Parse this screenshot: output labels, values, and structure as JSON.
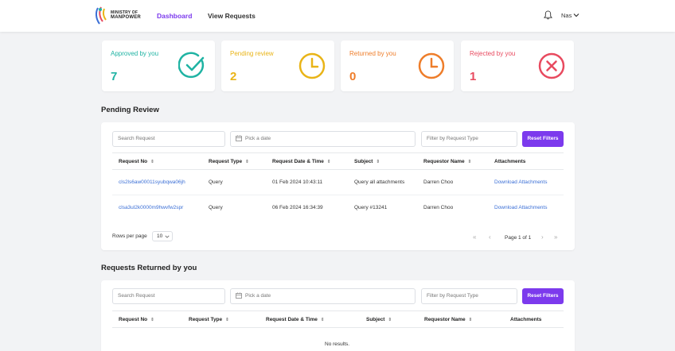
{
  "header": {
    "logo_line1": "MINISTRY OF",
    "logo_line2": "MANPOWER",
    "nav": [
      {
        "label": "Dashboard",
        "active": true
      },
      {
        "label": "View Requests",
        "active": false
      }
    ],
    "user": "Nas"
  },
  "summary": [
    {
      "label": "Approved by you",
      "value": "7",
      "color": "#1fb3a3",
      "icon": "check-circle-icon"
    },
    {
      "label": "Pending review",
      "value": "2",
      "color": "#e9b417",
      "icon": "clock-icon"
    },
    {
      "label": "Returned by you",
      "value": "0",
      "color": "#ee7d2a",
      "icon": "clock-icon"
    },
    {
      "label": "Rejected by you",
      "value": "1",
      "color": "#e84a5f",
      "icon": "x-circle-icon"
    }
  ],
  "pending": {
    "title": "Pending Review",
    "search_placeholder": "Search Request",
    "date_placeholder": "Pick a date",
    "type_placeholder": "Filter by Request Type",
    "reset_label": "Reset Filters",
    "columns": [
      "Request No",
      "Request Type",
      "Request Date & Time",
      "Subject",
      "Requestor Name",
      "Attachments"
    ],
    "rows": [
      {
        "no": "cls2ls6aw00011syubqwa06jh",
        "type": "Query",
        "date": "01 Feb 2024 10:43:11",
        "subject": "Query all attachments",
        "requestor": "Darren Choo",
        "attachments": "Download Attachments"
      },
      {
        "no": "clsa3ul2k0000m9hwvfw2spr",
        "type": "Query",
        "date": "06 Feb 2024 16:34:39",
        "subject": "Query #13241",
        "requestor": "Darren Choo",
        "attachments": "Download Attachments"
      }
    ],
    "rows_per_page_label": "Rows per page",
    "rows_per_page": "10",
    "page_text": "Page 1 of 1"
  },
  "returned": {
    "title": "Requests Returned by you",
    "search_placeholder": "Search Request",
    "date_placeholder": "Pick a date",
    "type_placeholder": "Filter by Request Type",
    "reset_label": "Reset Filters",
    "columns": [
      "Request No",
      "Request Type",
      "Request Date & Time",
      "Subject",
      "Requestor Name",
      "Attachments"
    ],
    "no_results": "No results."
  },
  "colors": {
    "accent": "#7c3aed",
    "link": "#3b6fd6"
  }
}
